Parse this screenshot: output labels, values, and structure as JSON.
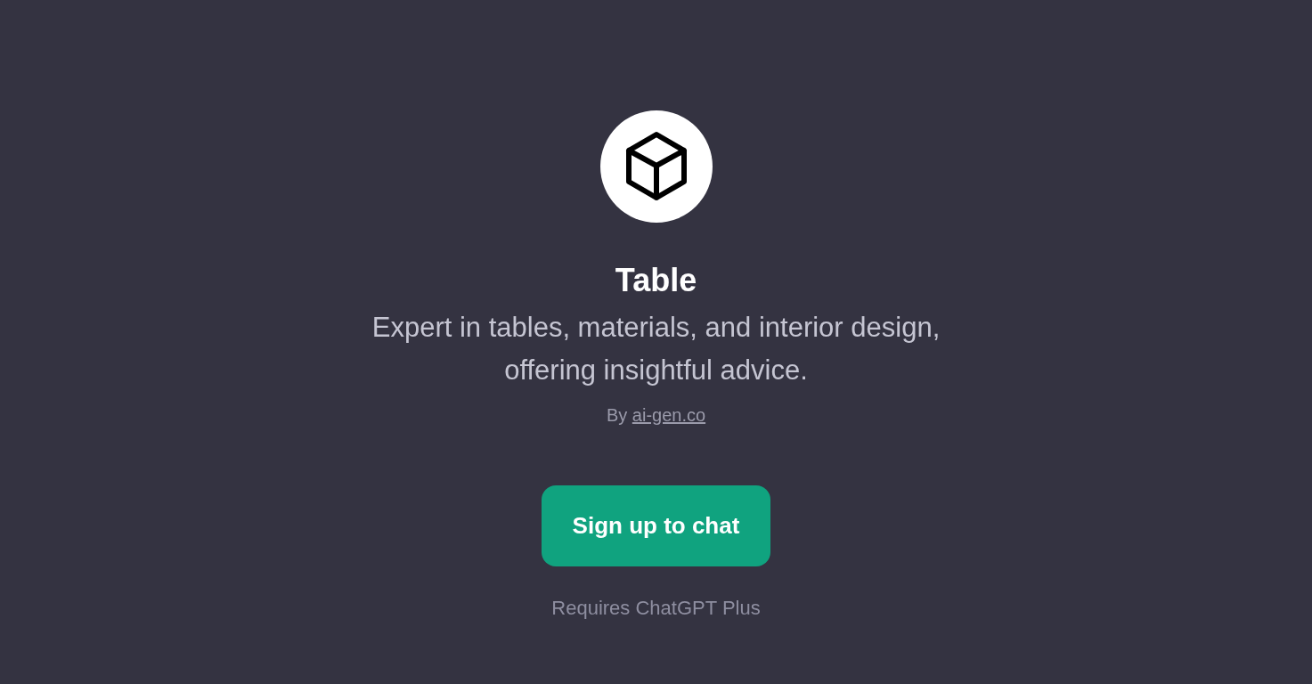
{
  "gpt": {
    "name": "Table",
    "description": "Expert in tables, materials, and interior design, offering insightful advice.",
    "author": {
      "prefix": "By",
      "link": "ai-gen.co"
    }
  },
  "signup_button": "Sign up to chat",
  "requirement_note": "Requires ChatGPT Plus"
}
